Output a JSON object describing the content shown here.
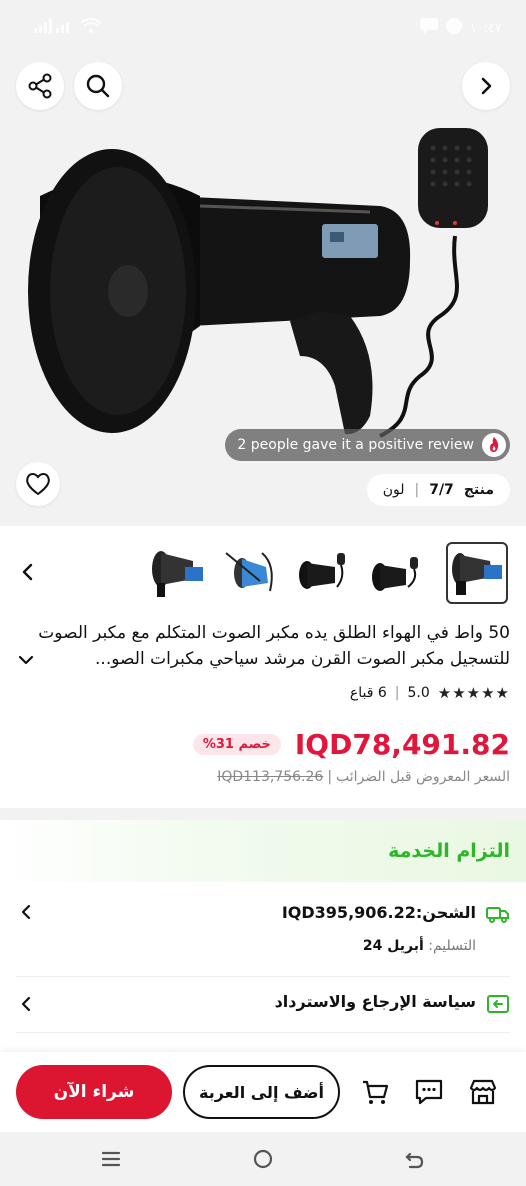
{
  "status_bar": {
    "time": "١٠:٤٧",
    "signal": "",
    "network": ""
  },
  "hero": {
    "review_text": "2 people gave it a positive review",
    "product_counter_label": "منتج",
    "product_counter_value": "7/7",
    "color_label": "لون"
  },
  "product": {
    "title": "50 واط في الهواء الطلق يده مكبر الصوت المتكلم مع مكبر الصوت للتسجيل مكبر الصوت القرن مرشد سياحي مكبرات الصو...",
    "rating_value": "5.0",
    "sold_count": "6 قباع",
    "stars": "★★★★★",
    "price": "IQD78,491.82",
    "discount": "خصم 31%",
    "old_price": "IQD113,756.26",
    "old_price_label": "السعر المعروض قبل الضرائب"
  },
  "service": {
    "title": "التزام الخدمة",
    "shipping_label": "الشحن:",
    "shipping_value": "IQD395,906.22",
    "delivery_label": "التسليم:",
    "delivery_value": "أبريل 24",
    "return_policy": "سياسة الإرجاع والاسترداد"
  },
  "actions": {
    "buy_now": "شراء الآن",
    "add_to_cart": "أضف إلى العربة"
  },
  "colors": {
    "accent": "#e0173c",
    "buy": "#dc1530",
    "service_green": "#2fb52a"
  }
}
